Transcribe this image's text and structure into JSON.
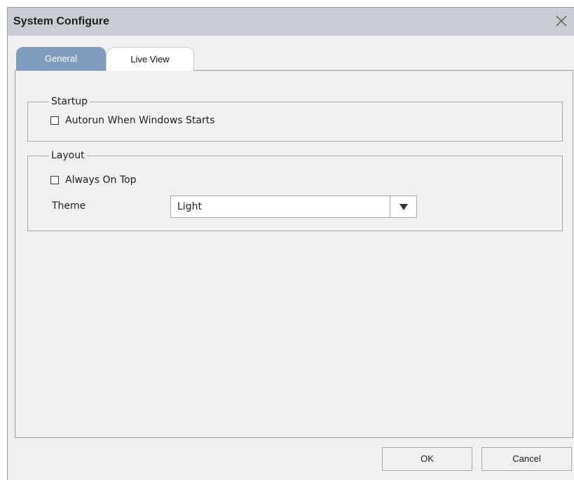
{
  "window": {
    "title": "System Configure"
  },
  "tabs": [
    {
      "label": "General",
      "active": true
    },
    {
      "label": "Live View",
      "active": false
    }
  ],
  "startup": {
    "legend": "Startup",
    "autorun": {
      "label": "Autorun When Windows Starts",
      "checked": false
    }
  },
  "layout": {
    "legend": "Layout",
    "always_on_top": {
      "label": "Always On Top",
      "checked": false
    },
    "theme": {
      "label": "Theme",
      "value": "Light"
    }
  },
  "footer": {
    "ok_label": "OK",
    "cancel_label": "Cancel"
  },
  "icons": {
    "close": "close-icon",
    "dropdown": "triangle-down-icon"
  },
  "colors": {
    "titlebar": "#c9cdd3",
    "active_tab": "#7f9bbd",
    "dialog_bg": "#f0f0f0"
  }
}
